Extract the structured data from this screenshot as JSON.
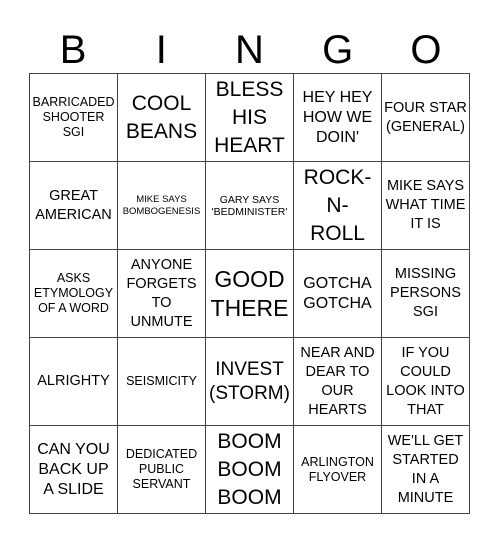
{
  "header": {
    "letters": [
      "B",
      "I",
      "N",
      "G",
      "O"
    ]
  },
  "board": {
    "rows": [
      [
        "BARRICADED SHOOTER SGI",
        "COOL BEANS",
        "BLESS HIS HEART",
        "HEY HEY HOW WE DOIN'",
        "FOUR STAR (GENERAL)"
      ],
      [
        "GREAT AMERICAN",
        "MIKE SAYS BOMBOGENESIS",
        "GARY SAYS 'BEDMINISTER'",
        "ROCK-N-ROLL",
        "MIKE SAYS WHAT TIME IT IS"
      ],
      [
        "ASKS ETYMOLOGY OF A WORD",
        "ANYONE FORGETS TO UNMUTE",
        "GOOD THERE",
        "GOTCHA GOTCHA",
        "MISSING PERSONS SGI"
      ],
      [
        "ALRIGHTY",
        "SEISMICITY",
        "INVEST (STORM)",
        "NEAR AND DEAR TO OUR HEARTS",
        "IF YOU COULD LOOK INTO THAT"
      ],
      [
        "CAN YOU BACK UP A SLIDE",
        "DEDICATED PUBLIC SERVANT",
        "BOOM BOOM BOOM",
        "ARLINGTON FLYOVER",
        "WE'LL GET STARTED IN A MINUTE"
      ]
    ]
  }
}
